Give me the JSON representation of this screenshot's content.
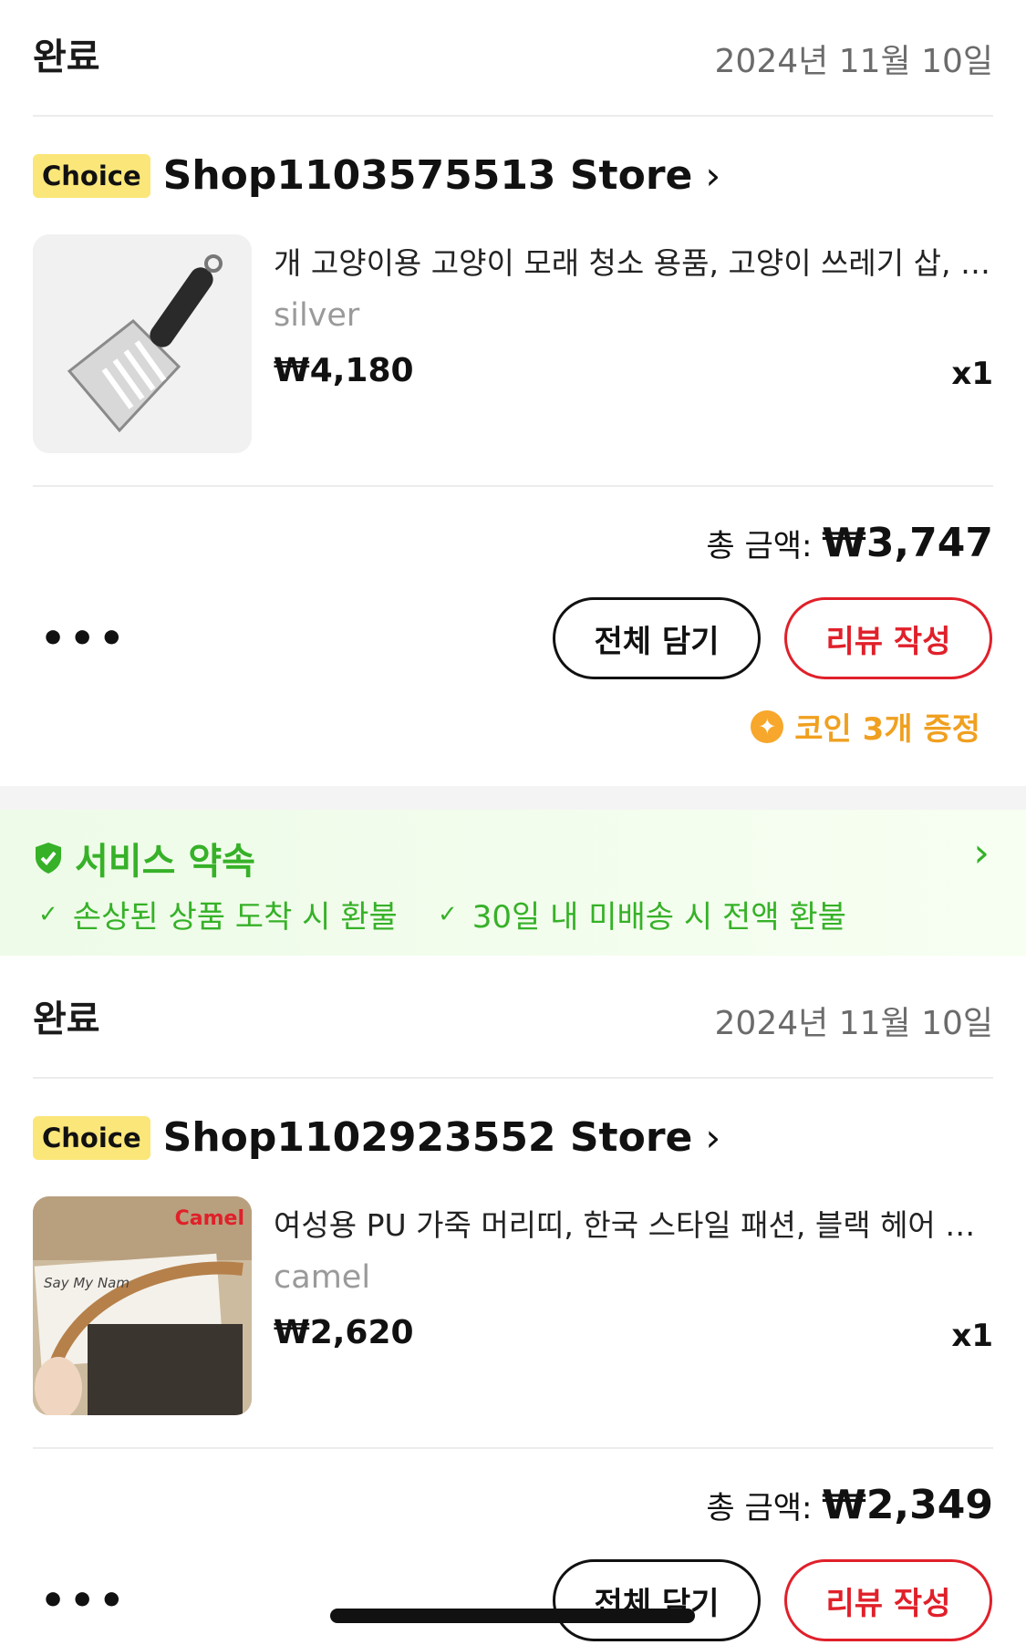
{
  "orders": [
    {
      "status": "완료",
      "date": "2024년 11월 10일",
      "choice_badge": "Choice",
      "store_name": "Shop1103575513 Store",
      "product_title": "개 고양이용 고양이 모래 청소 용품, 고양이 쓰레기 삽, 금속 고양이 모래 삽",
      "variant": "silver",
      "price": "₩4,180",
      "quantity": "x1",
      "total_label": "총 금액:",
      "total_value": "₩3,747",
      "more_label": "•••",
      "add_all_label": "전체 담기",
      "review_label": "리뷰 작성",
      "coin_text": "코인 3개 증정"
    },
    {
      "status": "완료",
      "date": "2024년 11월 10일",
      "choice_badge": "Choice",
      "store_name": "Shop1102923552 Store",
      "product_title": "여성용 PU 가죽 머리띠, 한국 스타일 패션, 블랙 헤어 액세서리",
      "variant": "camel",
      "price": "₩2,620",
      "quantity": "x1",
      "total_label": "총 금액:",
      "total_value": "₩2,349",
      "more_label": "•••",
      "add_all_label": "전체 담기",
      "review_label": "리뷰 작성",
      "thumb_caption": "Camel",
      "thumb_text": "Say My Nam"
    }
  ],
  "service_promise": {
    "title": "서비스 약속",
    "items": [
      "손상된 상품 도착 시 환불",
      "30일 내 미배송 시 전액 환불"
    ],
    "color": "#36b128"
  },
  "icons": {
    "chevron": "›",
    "check": "✓",
    "coin": "✦"
  },
  "colors": {
    "accent_red": "#e0202a",
    "choice_yellow": "#fbe67a",
    "coin_orange": "#f0a020"
  }
}
